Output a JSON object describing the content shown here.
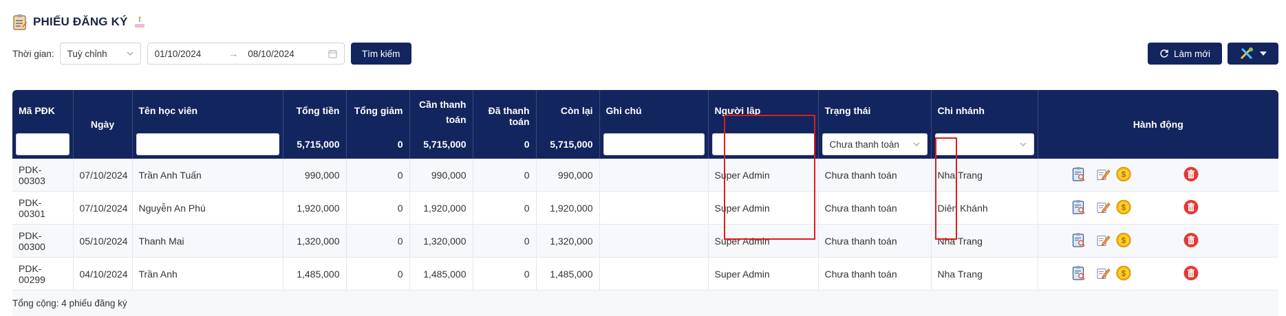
{
  "page": {
    "title": "PHIẾU ĐĂNG KÝ",
    "title_icon": "clipboard-icon",
    "title_badge_icon": "cake-icon"
  },
  "filter": {
    "time_label": "Thời gian:",
    "period_value": "Tuỳ chỉnh",
    "date_from": "01/10/2024",
    "date_to": "08/10/2024",
    "search_label": "Tìm kiếm"
  },
  "toolbar": {
    "refresh_label": "Làm mới",
    "refresh_icon": "refresh-icon",
    "tools_icon": "tools-icon"
  },
  "table": {
    "headers": {
      "code": "Mã PĐK",
      "date": "Ngày",
      "student": "Tên học viên",
      "total": "Tổng tiền",
      "discount": "Tổng giảm",
      "need_pay_1": "Cần thanh",
      "need_pay_2": "toán",
      "paid": "Đã thanh toán",
      "remaining": "Còn lại",
      "note": "Ghi chú",
      "creator": "Người lập",
      "status": "Trạng thái",
      "branch": "Chi nhánh",
      "actions": "Hành động"
    },
    "totals": {
      "total": "5,715,000",
      "discount": "0",
      "need_pay": "5,715,000",
      "paid": "0",
      "remaining": "5,715,000"
    },
    "status_filter_value": "Chưa thanh toán",
    "rows": [
      {
        "code": "PDK-00303",
        "date": "07/10/2024",
        "student": "Trần Anh Tuấn",
        "total": "990,000",
        "discount": "0",
        "need_pay": "990,000",
        "paid": "0",
        "remaining": "990,000",
        "note": "",
        "creator": "Super Admin",
        "status": "Chưa thanh toán",
        "branch": "Nha Trang"
      },
      {
        "code": "PDK-00301",
        "date": "07/10/2024",
        "student": "Nguyễn An Phú",
        "total": "1,920,000",
        "discount": "0",
        "need_pay": "1,920,000",
        "paid": "0",
        "remaining": "1,920,000",
        "note": "",
        "creator": "Super Admin",
        "status": "Chưa thanh toán",
        "branch": "Diên Khánh"
      },
      {
        "code": "PDK-00300",
        "date": "05/10/2024",
        "student": "Thanh Mai",
        "total": "1,320,000",
        "discount": "0",
        "need_pay": "1,320,000",
        "paid": "0",
        "remaining": "1,320,000",
        "note": "",
        "creator": "Super Admin",
        "status": "Chưa thanh toán",
        "branch": "Nha Trang"
      },
      {
        "code": "PDK-00299",
        "date": "04/10/2024",
        "student": "Trần Anh",
        "total": "1,485,000",
        "discount": "0",
        "need_pay": "1,485,000",
        "paid": "0",
        "remaining": "1,485,000",
        "note": "",
        "creator": "Super Admin",
        "status": "Chưa thanh toán",
        "branch": "Nha Trang"
      }
    ],
    "footer": "Tổng cộng: 4 phiếu đăng ký"
  },
  "colors": {
    "header_bg": "#13255e",
    "highlight": "#e01b1b",
    "delete": "#e53935",
    "coin": "#f5b800"
  }
}
